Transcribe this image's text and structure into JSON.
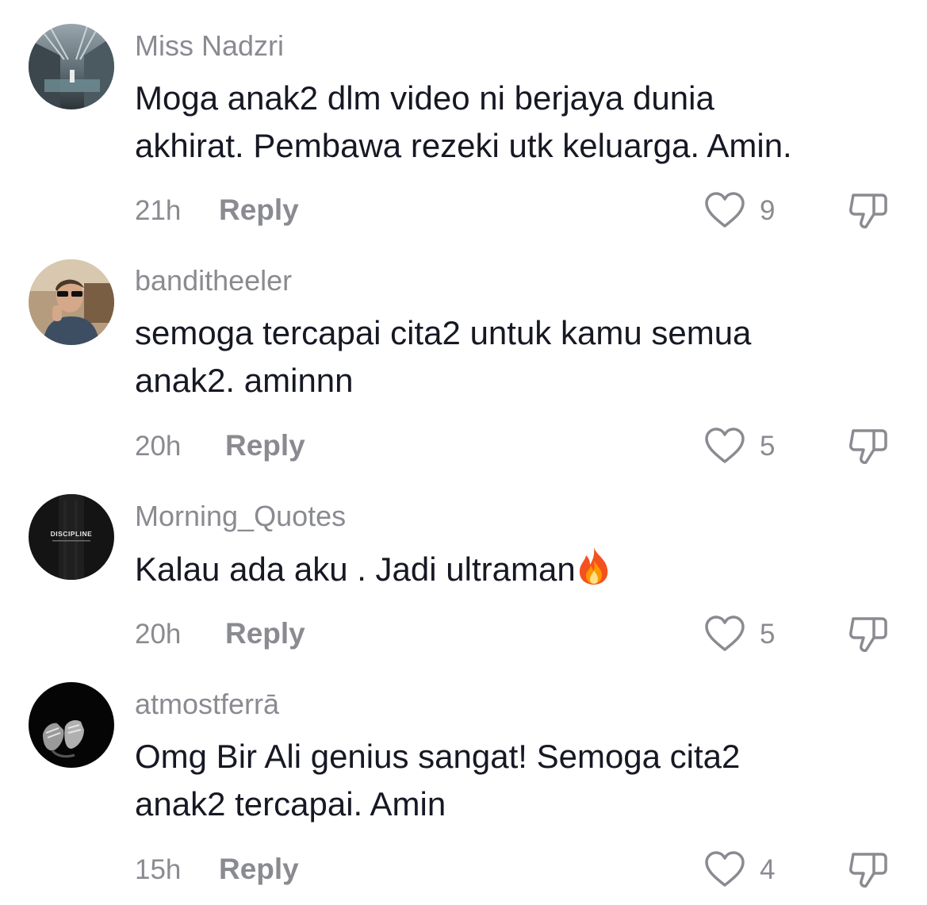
{
  "comments": [
    {
      "username": "Miss Nadzri",
      "text_line1": "Moga anak2 dlm video ni berjaya dunia",
      "text_line2": "akhirat. Pembawa rezeki utk keluarga. Amin.",
      "time": "21h",
      "reply_label": "Reply",
      "likes": "9",
      "avatar_icon": "building-interior-photo"
    },
    {
      "username": "banditheeler",
      "text_line1": "semoga tercapai cita2 untuk kamu semua",
      "text_line2": "anak2. aminnn",
      "time": "20h",
      "reply_label": "Reply",
      "likes": "5",
      "avatar_icon": "person-sunglasses-photo"
    },
    {
      "username": "Morning_Quotes",
      "text_line1": "Kalau ada aku . Jadi ultraman",
      "emoji": "fire-icon",
      "avatar_text": "DISCIPLINE",
      "time": "20h",
      "reply_label": "Reply",
      "likes": "5",
      "avatar_icon": "discipline-poster"
    },
    {
      "username": "atmostferrā",
      "text_line1": "Omg Bir Ali genius sangat! Semoga cita2",
      "text_line2": "anak2 tercapai. Amin",
      "time": "15h",
      "reply_label": "Reply",
      "likes": "4",
      "avatar_icon": "sneakers-dark-photo"
    }
  ],
  "colors": {
    "primary_text": "#161823",
    "secondary_text": "#8a8b91",
    "icon_stroke": "#8a8b91"
  }
}
